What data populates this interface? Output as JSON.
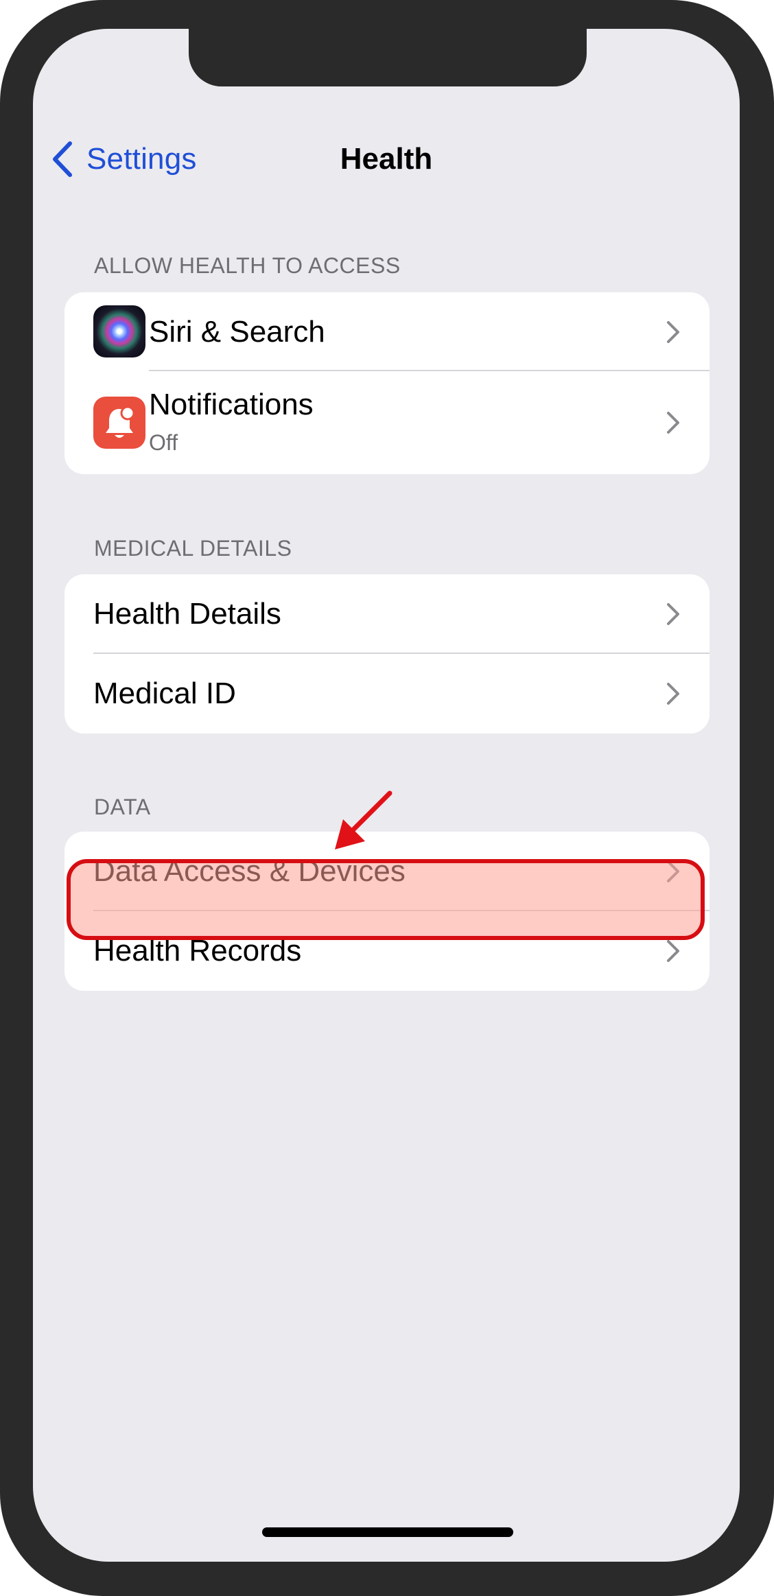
{
  "nav": {
    "back_label": "Settings",
    "title": "Health"
  },
  "sections": {
    "allow_access": {
      "header": "ALLOW HEALTH TO ACCESS",
      "items": [
        {
          "label": "Siri & Search",
          "icon": "siri-icon"
        },
        {
          "label": "Notifications",
          "sublabel": "Off",
          "icon": "bell-icon"
        }
      ]
    },
    "medical_details": {
      "header": "MEDICAL DETAILS",
      "items": [
        {
          "label": "Health Details"
        },
        {
          "label": "Medical ID"
        }
      ]
    },
    "data": {
      "header": "DATA",
      "items": [
        {
          "label": "Data Access & Devices",
          "highlighted": true
        },
        {
          "label": "Health Records"
        }
      ]
    }
  },
  "colors": {
    "accent": "#1f4fd6",
    "highlight_border": "#d60d12",
    "background": "#ebeaef"
  }
}
